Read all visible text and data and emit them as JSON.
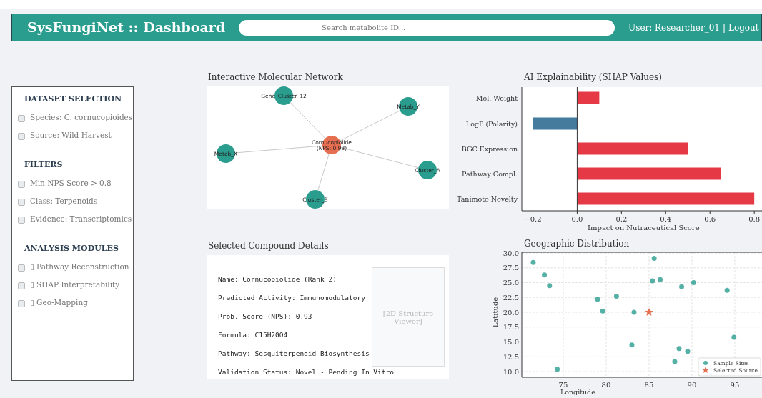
{
  "header": {
    "title": "SysFungiNet :: Dashboard",
    "search": {
      "placeholder": "Search metabolite ID..."
    },
    "user": "User: Researcher_01",
    "separator": "|",
    "logout": "Logout"
  },
  "sidebar": {
    "sections": [
      {
        "heading": "DATASET SELECTION",
        "items": [
          {
            "label": "Species: C. cornucopioides",
            "checked": false
          },
          {
            "label": "Source: Wild Harvest",
            "checked": false
          }
        ]
      },
      {
        "heading": "FILTERS",
        "items": [
          {
            "label": "Min NPS Score > 0.8",
            "checked": false
          },
          {
            "label": "Class: Terpenoids",
            "checked": false
          },
          {
            "label": "Evidence: Transcriptomics",
            "checked": false
          }
        ]
      },
      {
        "heading": "ANALYSIS MODULES",
        "items": [
          {
            "label": "▯ Pathway Reconstruction",
            "checked": false
          },
          {
            "label": "▯ SHAP Interpretability",
            "checked": false
          },
          {
            "label": "▯ Geo-Mapping",
            "checked": false
          }
        ]
      }
    ]
  },
  "network": {
    "title": "Interactive Molecular Network",
    "nodes": [
      {
        "label": "Gene_Cluster_12",
        "kind": "cluster"
      },
      {
        "label": "Metab_Y",
        "kind": "cluster"
      },
      {
        "label": "Cornucopiolide\n(NPS: 0.93)",
        "kind": "center"
      },
      {
        "label": "Metab_X",
        "kind": "cluster"
      },
      {
        "label": "Cluster_A",
        "kind": "cluster"
      },
      {
        "label": "Cluster_B",
        "kind": "cluster"
      }
    ]
  },
  "shap": {
    "title": "AI Explainability (SHAP Values)",
    "chart_data": {
      "type": "bar",
      "orientation": "horizontal",
      "stacked": true,
      "xlabel": "Impact on Nutraceutical Score",
      "categories": [
        "Mol. Weight",
        "LogP (Polarity)",
        "BGC Expression",
        "Pathway Compl.",
        "Tanimoto Novelty"
      ],
      "series": [
        {
          "color": "#e63946",
          "values": [
            0.1,
            null,
            0.5,
            0.65,
            0.8
          ]
        },
        {
          "color": "#457b9d",
          "values": [
            null,
            -0.2,
            null,
            null,
            null
          ]
        }
      ],
      "xlim": [
        -0.25,
        0.835
      ],
      "xticks": [
        {
          "value": -0.2,
          "label": "−0.2"
        },
        {
          "value": 0,
          "label": "0.0"
        },
        {
          "value": 0.2,
          "label": "0.2"
        },
        {
          "value": 0.4,
          "label": "0.4"
        },
        {
          "value": 0.6,
          "label": "0.6"
        },
        {
          "value": 0.8,
          "label": "0.8"
        }
      ]
    }
  },
  "compound": {
    "title": "Selected Compound Details",
    "lines": [
      "Name: Cornucopiolide (Rank 2)",
      "Predicted Activity: Immunomodulatory",
      "Prob. Score (NPS): 0.93",
      "Formula: C15H20O4",
      "Pathway: Sesquiterpenoid Biosynthesis",
      "Validation Status: Novel - Pending In Vitro"
    ],
    "viewer": "[2D Structure\nViewer]"
  },
  "geo": {
    "title": "Geographic Distribution",
    "chart_data": {
      "type": "scatter",
      "grid": true,
      "legend": true,
      "xlabel": "Longitude",
      "ylabel": "Latitude",
      "xlim": [
        70.17,
        98.17
      ],
      "ylim": [
        9.04,
        30.12
      ],
      "xticks": [
        75,
        80,
        85,
        90,
        95
      ],
      "yticks": [
        {
          "value": 10,
          "label": "10.0"
        },
        {
          "value": 12.5,
          "label": "12.5"
        },
        {
          "value": 15,
          "label": "15.0"
        },
        {
          "value": 17.5,
          "label": "17.5"
        },
        {
          "value": 20,
          "label": "20.0"
        },
        {
          "value": 22.5,
          "label": "22.5"
        },
        {
          "value": 25,
          "label": "25.0"
        },
        {
          "value": 27.5,
          "label": "27.5"
        },
        {
          "value": 30,
          "label": "30.0"
        }
      ],
      "series": [
        {
          "name": "Sample Sites",
          "color": "#2a9d8f",
          "x": [
            71.5,
            72.8,
            73.4,
            74.3,
            79.0,
            79.6,
            81.2,
            83.25,
            83.0,
            85.6,
            85.4,
            86.3,
            88.8,
            90.2,
            94.1,
            94.9,
            88.5,
            89.5,
            88.0
          ],
          "values": [
            28.4,
            26.3,
            24.5,
            10.4,
            22.2,
            20.2,
            22.7,
            20.0,
            14.5,
            29.1,
            25.3,
            25.5,
            24.3,
            25.0,
            23.7,
            15.8,
            13.9,
            13.4,
            11.7
          ]
        },
        {
          "name": "Selected Source",
          "color": "#e76f51",
          "x": [
            85
          ],
          "values": [
            20
          ]
        }
      ]
    }
  }
}
